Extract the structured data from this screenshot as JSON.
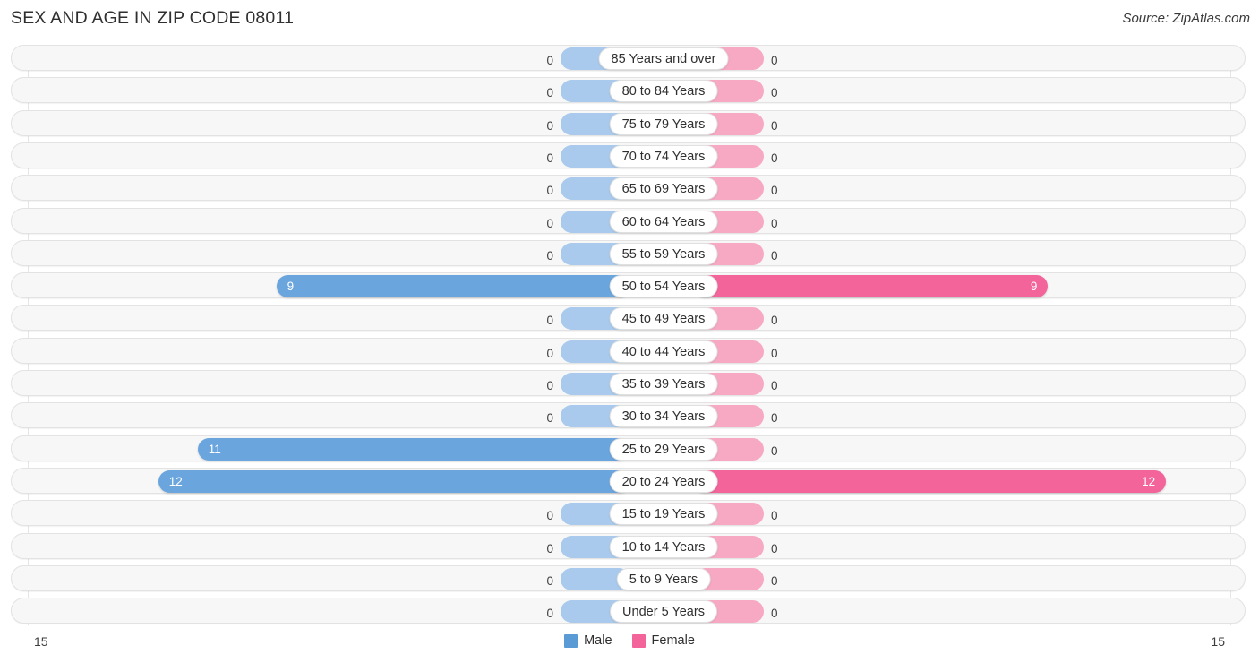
{
  "header": {
    "title": "SEX AND AGE IN ZIP CODE 08011",
    "source": "Source: ZipAtlas.com"
  },
  "legend": {
    "male_label": "Male",
    "female_label": "Female",
    "male_color": "#5b9bd5",
    "female_color": "#f2649a"
  },
  "axis": {
    "left_max": "15",
    "right_max": "15"
  },
  "chart_data": {
    "type": "bar",
    "title": "SEX AND AGE IN ZIP CODE 08011",
    "subtitle": "Source: ZipAtlas.com",
    "orientation": "horizontal",
    "layout": "population-pyramid",
    "xlabel": "",
    "ylabel": "",
    "xlim": [
      15,
      15
    ],
    "grid": false,
    "legend_position": "bottom-center",
    "categories": [
      "85 Years and over",
      "80 to 84 Years",
      "75 to 79 Years",
      "70 to 74 Years",
      "65 to 69 Years",
      "60 to 64 Years",
      "55 to 59 Years",
      "50 to 54 Years",
      "45 to 49 Years",
      "40 to 44 Years",
      "35 to 39 Years",
      "30 to 34 Years",
      "25 to 29 Years",
      "20 to 24 Years",
      "15 to 19 Years",
      "10 to 14 Years",
      "5 to 9 Years",
      "Under 5 Years"
    ],
    "series": [
      {
        "name": "Male",
        "color": "#5b9bd5",
        "values": [
          0,
          0,
          0,
          0,
          0,
          0,
          0,
          9,
          0,
          0,
          0,
          0,
          11,
          12,
          0,
          0,
          0,
          0
        ]
      },
      {
        "name": "Female",
        "color": "#f2649a",
        "values": [
          0,
          0,
          0,
          0,
          0,
          0,
          0,
          9,
          0,
          0,
          0,
          0,
          0,
          12,
          0,
          0,
          0,
          0
        ]
      }
    ]
  }
}
